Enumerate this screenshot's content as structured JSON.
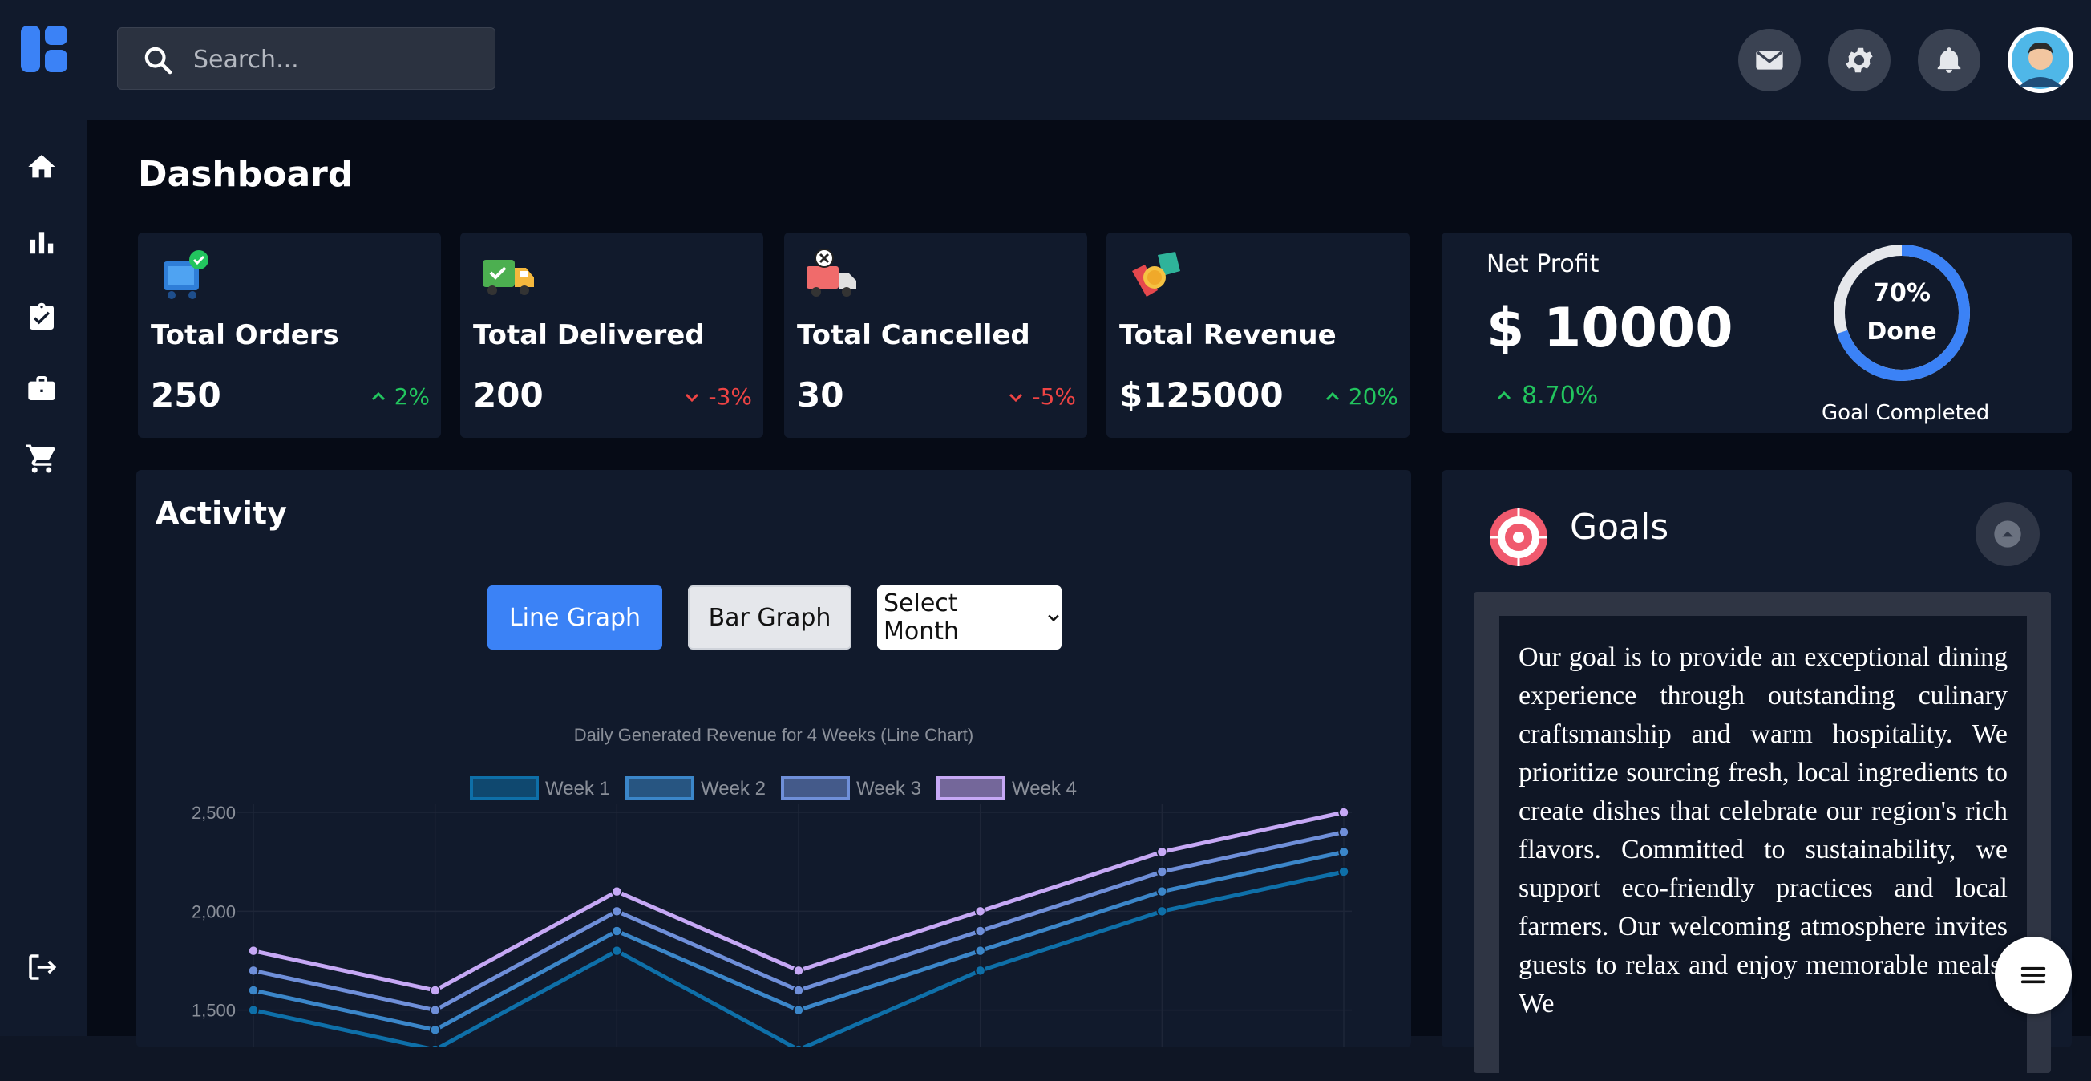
{
  "header": {
    "search_placeholder": "Search..."
  },
  "colors": {
    "accent": "#3b82f6",
    "up": "#22c55e",
    "down": "#ef4444",
    "background": "#060b16",
    "card": "#111a2c"
  },
  "sidebar": {
    "items": [
      {
        "icon": "home-icon"
      },
      {
        "icon": "bar-chart-icon"
      },
      {
        "icon": "clipboard-check-icon"
      },
      {
        "icon": "briefcase-icon"
      },
      {
        "icon": "cart-icon"
      }
    ],
    "logout_icon": "logout-icon"
  },
  "page": {
    "title": "Dashboard"
  },
  "stats": [
    {
      "label": "Total Orders",
      "value": "250",
      "change": "2%",
      "trend": "up",
      "icon": "orders-icon"
    },
    {
      "label": "Total Delivered",
      "value": "200",
      "change": "-3%",
      "trend": "down",
      "icon": "delivery-truck-icon"
    },
    {
      "label": "Total Cancelled",
      "value": "30",
      "change": "-5%",
      "trend": "down",
      "icon": "cancelled-truck-icon"
    },
    {
      "label": "Total Revenue",
      "value": "$125000",
      "change": "20%",
      "trend": "up",
      "icon": "revenue-icon"
    }
  ],
  "profit": {
    "title": "Net Profit",
    "value": "$ 10000",
    "change": "8.70%",
    "progress_percent": 70,
    "ring_line1": "70%",
    "ring_line2": "Done",
    "goal_label": "Goal Completed"
  },
  "activity": {
    "title": "Activity",
    "line_button": "Line Graph",
    "bar_button": "Bar Graph",
    "select_month": "Select Month"
  },
  "chart_data": {
    "type": "line",
    "title": "Daily Generated Revenue for 4 Weeks (Line Chart)",
    "xlabel": "",
    "ylabel": "",
    "ylim": [
      1300,
      2500
    ],
    "yticks": [
      "2,500",
      "2,000",
      "1,500"
    ],
    "ytick_values": [
      2500,
      2000,
      1500
    ],
    "grid": true,
    "legend": "top",
    "series": [
      {
        "name": "Week 1",
        "color": "#0e6fa8",
        "values": [
          1500,
          1300,
          1800,
          1300,
          1700,
          2000,
          2200
        ]
      },
      {
        "name": "Week 2",
        "color": "#3b86c9",
        "values": [
          1600,
          1400,
          1900,
          1500,
          1800,
          2100,
          2300
        ]
      },
      {
        "name": "Week 3",
        "color": "#6f8fd9",
        "values": [
          1700,
          1500,
          2000,
          1600,
          1900,
          2200,
          2400
        ]
      },
      {
        "name": "Week 4",
        "color": "#c6a8f5",
        "values": [
          1800,
          1600,
          2100,
          1700,
          2000,
          2300,
          2500
        ]
      }
    ]
  },
  "goals": {
    "title": "Goals",
    "text": "Our goal is to provide an exceptional dining experience through outstanding culinary craftsmanship and warm hospitality. We prioritize sourcing fresh, local ingredients to create dishes that celebrate our region's rich flavors. Committed to sustainability, we support eco-friendly practices and local farmers. Our welcoming atmosphere invites guests to relax and enjoy memorable meals. We"
  }
}
